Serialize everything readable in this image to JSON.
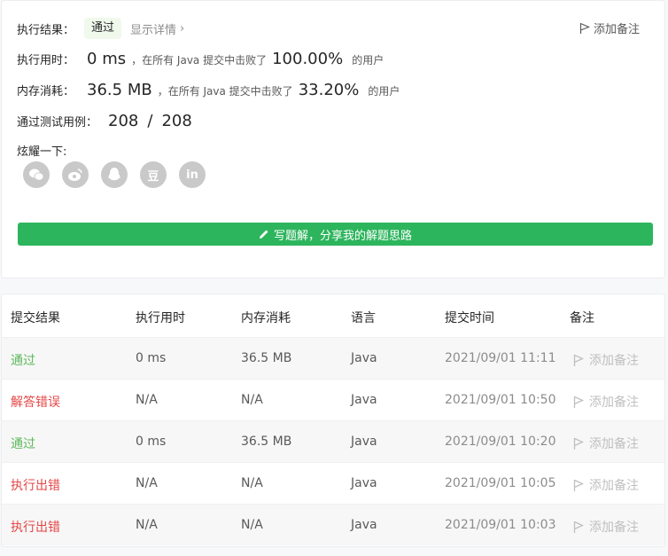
{
  "summary": {
    "result_label": "执行结果：",
    "result_badge": "通过",
    "details_link": "显示详情",
    "add_note": "添加备注",
    "runtime_label": "执行用时：",
    "runtime_value": "0 ms",
    "runtime_text": "，在所有 Java 提交中击败了",
    "runtime_pct": "100.00%",
    "runtime_suffix": "的用户",
    "memory_label": "内存消耗：",
    "memory_value": "36.5 MB",
    "memory_text": "，在所有 Java 提交中击败了",
    "memory_pct": "33.20%",
    "memory_suffix": "的用户",
    "tests_label": "通过测试用例：",
    "tests_passed": "208",
    "tests_sep": "/",
    "tests_total": "208",
    "share_label": "炫耀一下:",
    "share_icons": [
      "wechat-icon",
      "weibo-icon",
      "qq-icon",
      "douban-icon",
      "linkedin-icon"
    ],
    "share_glyphs": [
      "",
      "",
      "",
      "豆",
      "in"
    ],
    "write_button": "写题解，分享我的解题思路"
  },
  "table": {
    "headers": [
      "提交结果",
      "执行用时",
      "内存消耗",
      "语言",
      "提交时间",
      "备注"
    ],
    "rows": [
      {
        "result": "通过",
        "status": "ok",
        "runtime": "0 ms",
        "memory": "36.5 MB",
        "lang": "Java",
        "time": "2021/09/01 11:11",
        "note": "添加备注"
      },
      {
        "result": "解答错误",
        "status": "err",
        "runtime": "N/A",
        "memory": "N/A",
        "lang": "Java",
        "time": "2021/09/01 10:50",
        "note": "添加备注"
      },
      {
        "result": "通过",
        "status": "ok",
        "runtime": "0 ms",
        "memory": "36.5 MB",
        "lang": "Java",
        "time": "2021/09/01 10:20",
        "note": "添加备注"
      },
      {
        "result": "执行出错",
        "status": "err",
        "runtime": "N/A",
        "memory": "N/A",
        "lang": "Java",
        "time": "2021/09/01 10:05",
        "note": "添加备注"
      },
      {
        "result": "执行出错",
        "status": "err",
        "runtime": "N/A",
        "memory": "N/A",
        "lang": "Java",
        "time": "2021/09/01 10:03",
        "note": "添加备注"
      }
    ]
  },
  "colors": {
    "accent": "#2db55d",
    "success": "#5cb85c",
    "error": "#e54545"
  }
}
